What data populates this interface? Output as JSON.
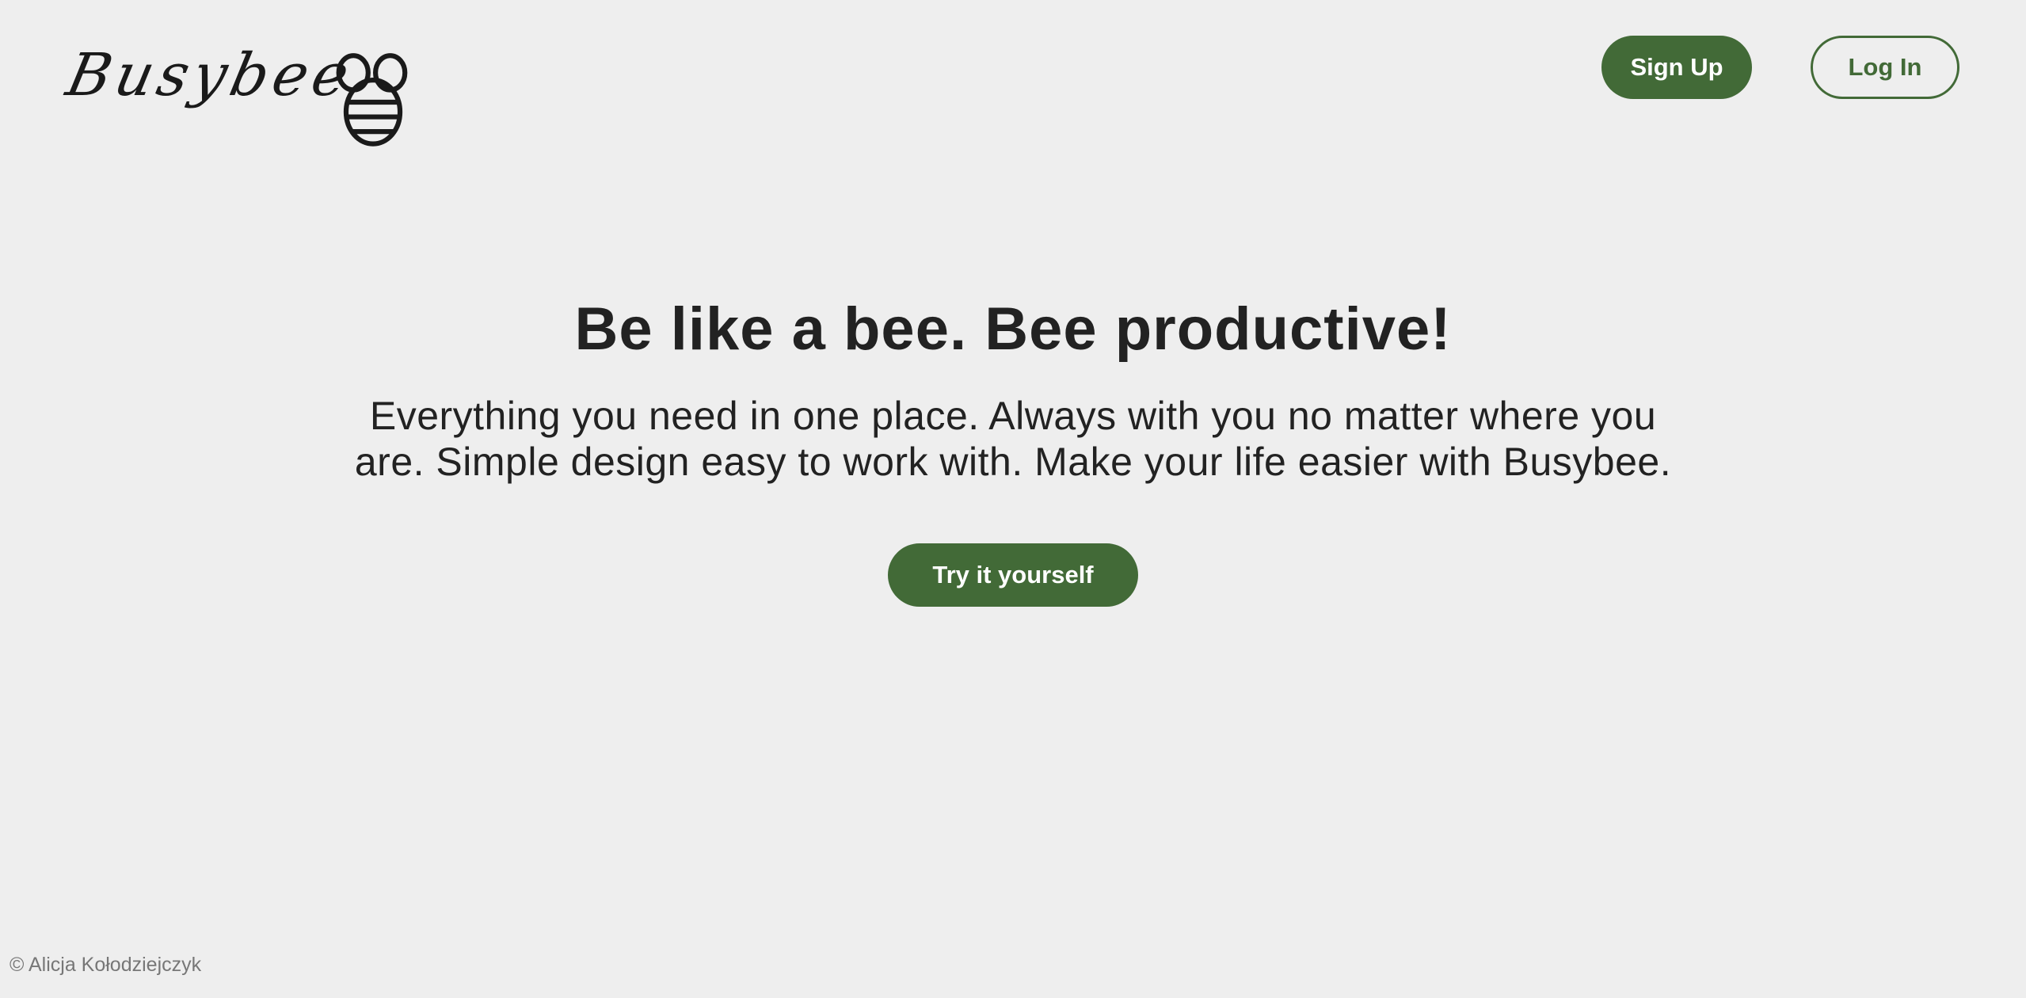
{
  "header": {
    "logo_text": "Busybee",
    "signup_label": "Sign Up",
    "login_label": "Log In"
  },
  "hero": {
    "title": "Be like a bee. Bee productive!",
    "subtitle": "Everything you need in one place. Always with you no matter where you are. Simple design easy to work with. Make your life easier with Busybee.",
    "cta_label": "Try it yourself"
  },
  "footer": {
    "copyright": "© Alicja Kołodziejczyk"
  },
  "colors": {
    "background": "#eeeeee",
    "accent": "#426a37",
    "text": "#222222",
    "muted": "#777777"
  },
  "icons": {
    "logo_mark": "bee-icon"
  }
}
